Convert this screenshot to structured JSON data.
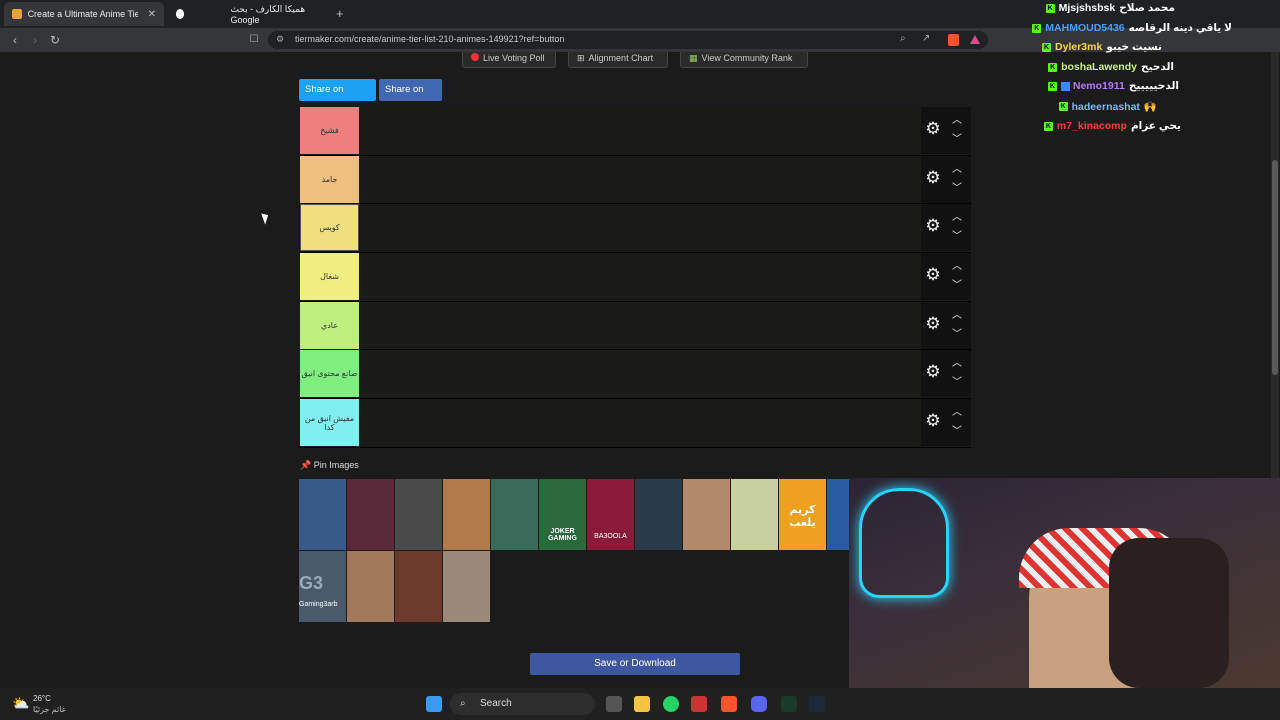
{
  "browser": {
    "tabs": [
      {
        "title": "Create a Ultimate Anime Tier Li...",
        "active": true
      },
      {
        "title": "هميكا الكارف - بحث Google",
        "active": false
      }
    ],
    "url": "tiermaker.com/create/anime-tier-list-210-animes-149921?ref=button"
  },
  "page": {
    "top_buttons": [
      "Live Voting Poll",
      "Alignment Chart",
      "View Community Rank"
    ],
    "share_twitter": "Share on Twitter",
    "share_fb": "Share on FB",
    "pin_label": "Pin Images",
    "save_label": "Save or Download",
    "tiers": [
      {
        "label": "فشيخ",
        "color": "#ef7f7f"
      },
      {
        "label": "جامد",
        "color": "#efbf7f"
      },
      {
        "label": "كويس",
        "color": "#efdf7f"
      },
      {
        "label": "شغال",
        "color": "#efef7f"
      },
      {
        "label": "عادي",
        "color": "#bfef7f"
      },
      {
        "label": "صانع محتوى انيق",
        "color": "#7fef7f"
      },
      {
        "label": "مفيش انيق من كدا",
        "color": "#7fefef"
      }
    ],
    "pool_images": [
      {
        "name": "creator-1",
        "color": "#3a5a8a"
      },
      {
        "name": "creator-2",
        "color": "#5a2a3a"
      },
      {
        "name": "creator-3",
        "color": "#4a4a4a"
      },
      {
        "name": "creator-4",
        "color": "#b07a4a"
      },
      {
        "name": "creator-5",
        "color": "#3a6a5a"
      },
      {
        "name": "creator-6",
        "color": "#2a6a3a"
      },
      {
        "name": "creator-7",
        "color": "#8a1a3a"
      },
      {
        "name": "creator-8",
        "color": "#2a3a4a"
      },
      {
        "name": "creator-9",
        "color": "#b08a6a"
      },
      {
        "name": "creator-10",
        "color": "#c8d0a0"
      },
      {
        "name": "creator-11",
        "color": "#f0a020"
      },
      {
        "name": "creator-12",
        "color": "#2a5aa0"
      },
      {
        "name": "creator-13",
        "color": "#4a5a6a"
      },
      {
        "name": "creator-14",
        "color": "#a07a5a"
      },
      {
        "name": "creator-15",
        "color": "#6a3a2a"
      },
      {
        "name": "creator-16",
        "color": "#9a8a7a"
      }
    ],
    "pool_texts": {
      "gaming3arb": "Gaming3arb",
      "joker": "JOKER GAMING",
      "bq": "BA3OOLA",
      "karim": "كريم يلعب"
    }
  },
  "chat": [
    {
      "user": "Mjsjshsbsk",
      "color": "#ffffff",
      "msg": "محمد صلاح"
    },
    {
      "user": "MAHMOUD5436",
      "color": "#4a9eff",
      "msg": "لا ياقي دينه الرقاصه"
    },
    {
      "user": "Dyler3mk",
      "color": "#f5d547",
      "msg": "نسيت خيبو"
    },
    {
      "user": "boshaLawendy",
      "color": "#c8f57a",
      "msg": "الدحيح"
    },
    {
      "user": "Nemo1911",
      "color": "#b57aff",
      "msg": "الدحيييييح"
    },
    {
      "user": "hadeernashat",
      "color": "#7ab8ff",
      "msg": "🙌"
    },
    {
      "user": "m7_kinacomp",
      "color": "#ff3a3a",
      "msg": "يحي عزام"
    }
  ],
  "taskbar": {
    "weather_temp": "26°C",
    "weather_desc": "غائم جزئيًا",
    "search_label": "Search"
  }
}
